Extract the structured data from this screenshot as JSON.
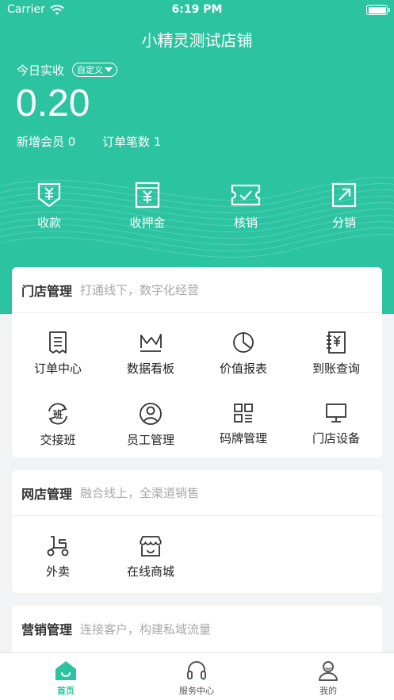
{
  "status_bar": {
    "carrier": "Carrier",
    "time": "6:19 PM"
  },
  "header": {
    "store_name": "小精灵测试店铺"
  },
  "summary": {
    "today_label": "今日实收",
    "custom_label": "自定义",
    "amount": "0.20",
    "new_members_label": "新增会员 0",
    "order_count_label": "订单笔数 1"
  },
  "quick_actions": [
    {
      "label": "收款",
      "icon": "payment-receipt-icon"
    },
    {
      "label": "收押金",
      "icon": "deposit-icon"
    },
    {
      "label": "核销",
      "icon": "ticket-verify-icon"
    },
    {
      "label": "分销",
      "icon": "share-arrow-icon"
    }
  ],
  "store_management": {
    "title": "门店管理",
    "subtitle": "打通线下，数字化经营",
    "items": [
      {
        "label": "订单中心",
        "icon": "order-list-icon"
      },
      {
        "label": "数据看板",
        "icon": "line-chart-icon"
      },
      {
        "label": "价值报表",
        "icon": "pie-chart-icon"
      },
      {
        "label": "到账查询",
        "icon": "yuan-notebook-icon"
      },
      {
        "label": "交接班",
        "icon": "shift-handover-icon"
      },
      {
        "label": "员工管理",
        "icon": "user-circle-icon"
      },
      {
        "label": "码牌管理",
        "icon": "qr-code-icon"
      },
      {
        "label": "门店设备",
        "icon": "monitor-icon"
      }
    ]
  },
  "online_store": {
    "title": "网店管理",
    "subtitle": "融合线上，全渠道销售",
    "items": [
      {
        "label": "外卖",
        "icon": "scooter-icon"
      },
      {
        "label": "在线商城",
        "icon": "storefront-icon"
      }
    ]
  },
  "marketing": {
    "title": "营销管理",
    "subtitle": "连接客户，构建私域流量"
  },
  "tabbar": {
    "items": [
      {
        "label": "首页",
        "icon": "home-icon",
        "active": true
      },
      {
        "label": "服务中心",
        "icon": "headset-icon",
        "active": false
      },
      {
        "label": "我的",
        "icon": "profile-icon",
        "active": false
      }
    ]
  },
  "colors": {
    "brand": "#2cc3a1",
    "background": "#f2f3f5",
    "muted_text": "#a9a9a9"
  }
}
